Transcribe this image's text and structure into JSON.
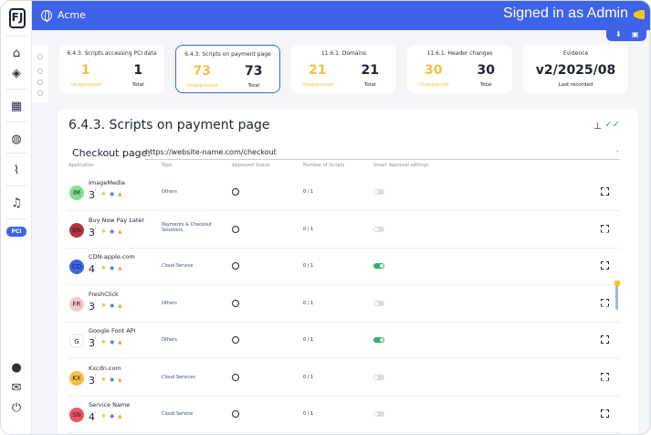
{
  "app": {
    "name": "Acme",
    "signed_in": "Signed in as Admin"
  },
  "sidebar": {
    "pci_label": "PCI"
  },
  "cards": [
    {
      "title": "6.4.3. Scripts accessing PCI data",
      "unapproved": "1",
      "total": "1",
      "unapproved_label": "Unapproved",
      "total_label": "Total"
    },
    {
      "title": "6.4.3. Scripts on payment page",
      "unapproved": "73",
      "total": "73",
      "unapproved_label": "Unapproved",
      "total_label": "Total"
    },
    {
      "title": "11.6.1. Domains",
      "unapproved": "21",
      "total": "21",
      "unapproved_label": "Unapproved",
      "total_label": "Total"
    },
    {
      "title": "11.6.1. Header changes",
      "unapproved": "30",
      "total": "30",
      "unapproved_label": "Unapproved",
      "total_label": "Total"
    },
    {
      "title": "Evidence",
      "value": "v2/2025/08",
      "label": "Last recorded"
    }
  ],
  "main": {
    "title": "6.4.3. Scripts on payment page",
    "checkout_label": "Checkout page:",
    "checkout_url": "https://website-name.com/checkout",
    "columns": [
      "Application",
      "Type",
      "Approved Status",
      "Number of Scripts",
      "Smart Approval settings"
    ]
  },
  "rows": [
    {
      "initials": "IM",
      "color": "#7ee08f",
      "name": "ImageMedia",
      "score": "3",
      "type": "Others",
      "scripts": "0 / 1",
      "toggle": false
    },
    {
      "initials": "BN",
      "color": "#b5353f",
      "name": "Buy Now Pay Later",
      "score": "3",
      "type": "Payments & Checkout Solutions",
      "scripts": "0 / 1",
      "toggle": false
    },
    {
      "initials": "CD",
      "color": "#3f63e8",
      "name": "CDN-apple.com",
      "score": "4",
      "type": "Cloud Service",
      "scripts": "0 / 1",
      "toggle": true
    },
    {
      "initials": "FR",
      "color": "#f7c7cf",
      "name": "FreshClick",
      "score": "3",
      "type": "Others",
      "scripts": "0 / 1",
      "toggle": false
    },
    {
      "initials": "G",
      "color": "#ffffff",
      "name": "Google Font API",
      "score": "3",
      "type": "Others",
      "scripts": "0 / 1",
      "toggle": true
    },
    {
      "initials": "KX",
      "color": "#f5c042",
      "name": "Kxcdn.com",
      "score": "3",
      "type": "Cloud Services",
      "scripts": "0 / 1",
      "toggle": false
    },
    {
      "initials": "SN",
      "color": "#ef5261",
      "name": "Service Name",
      "score": "4",
      "type": "Cloud Service",
      "scripts": "0 / 1",
      "toggle": false
    }
  ],
  "icons": [
    "home-icon",
    "layers-icon",
    "apps-icon",
    "globe-icon",
    "analytics-icon",
    "bell-icon",
    "user-icon",
    "mail-icon",
    "power-icon",
    "megaphone-icon",
    "download-icon",
    "briefcase-icon",
    "sitemap-icon",
    "double-check-icon",
    "expand-icon"
  ]
}
